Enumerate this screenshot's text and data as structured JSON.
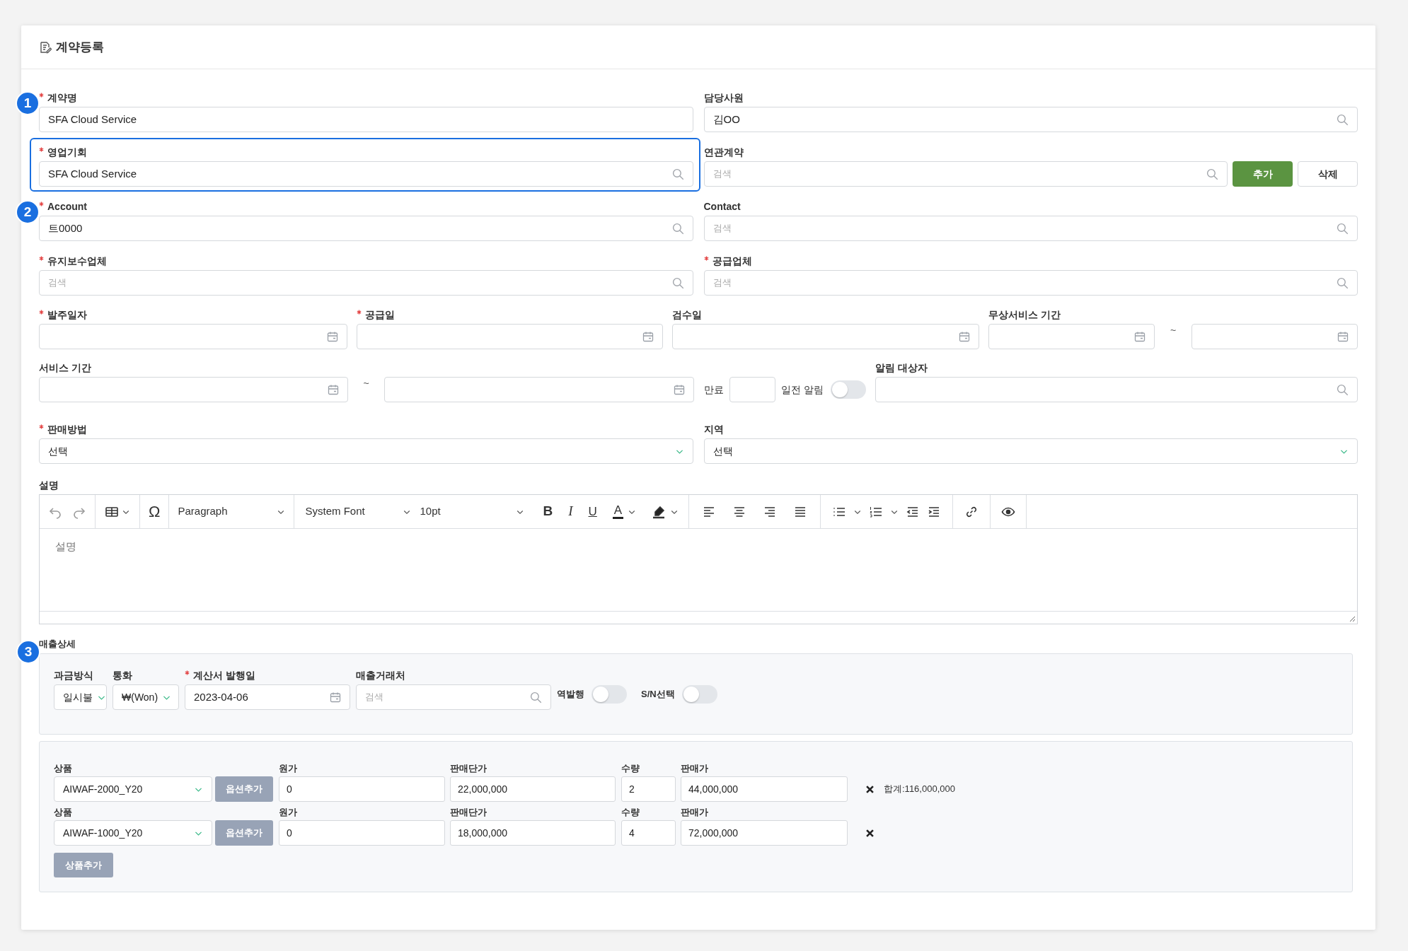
{
  "title": "계약등록",
  "main": [
    {
      "label": "계약명",
      "required": true,
      "kind": "text",
      "value": "SFA Cloud Service",
      "step": "1",
      "highlighted": false
    },
    {
      "label": "담당사원",
      "required": false,
      "kind": "search",
      "value": "김OO",
      "highlighted": false
    },
    {
      "label": "영업기회",
      "required": true,
      "kind": "search",
      "value": "SFA Cloud Service",
      "highlighted": true
    },
    {
      "label": "연관계약",
      "required": false,
      "kind": "search",
      "placeholder": "검색",
      "highlighted": false,
      "buttons": [
        {
          "label": "추가",
          "kind": "primary"
        },
        {
          "label": "삭제",
          "kind": "secondary"
        }
      ]
    },
    {
      "label": "Account",
      "required": true,
      "kind": "search",
      "value": "트0000",
      "step": "2",
      "highlighted": false
    },
    {
      "label": "Contact",
      "required": false,
      "kind": "search",
      "placeholder": "검색",
      "highlighted": false
    },
    {
      "label": "유지보수업체",
      "required": true,
      "kind": "search",
      "placeholder": "검색",
      "highlighted": false
    },
    {
      "label": "공급업체",
      "required": true,
      "kind": "search",
      "placeholder": "검색",
      "highlighted": false
    }
  ],
  "dates": [
    {
      "label": "발주일자",
      "required": true,
      "kind": "date"
    },
    {
      "label": "공급일",
      "required": true,
      "kind": "date"
    },
    {
      "label": "검수일",
      "required": false,
      "kind": "date"
    },
    {
      "label": "무상서비스 기간",
      "required": false,
      "kind": "date_range",
      "separator": "~"
    }
  ],
  "service": {
    "label": "서비스 기간",
    "separator": "~",
    "expiry_label": "만료",
    "notice": {
      "label": "일전 알림",
      "on": false
    },
    "recipients": {
      "label": "알림 대상자",
      "required": false,
      "kind": "search"
    }
  },
  "selects": [
    {
      "label": "판매방법",
      "required": true,
      "kind": "select",
      "value": "선택"
    },
    {
      "label": "지역",
      "required": false,
      "kind": "select",
      "value": "선택"
    }
  ],
  "description": {
    "label": "설명",
    "placeholder": "설명",
    "toolbar": {
      "special_char": "Ω",
      "block_format": "Paragraph",
      "font": "System Font",
      "font_size": "10pt",
      "bold": "B",
      "italic": "I",
      "underline": "U",
      "text_color": "A"
    }
  },
  "sales": {
    "label": "매출상세",
    "step": "3",
    "fields": [
      {
        "label": "과금방식",
        "required": false,
        "kind": "select",
        "value": "일시불"
      },
      {
        "label": "통화",
        "required": false,
        "kind": "select",
        "value": "₩(Won)"
      },
      {
        "label": "계산서 발행일",
        "required": true,
        "kind": "date",
        "value": "2023-04-06"
      },
      {
        "label": "매출거래처",
        "required": false,
        "kind": "search",
        "placeholder": "검색"
      }
    ],
    "toggles": [
      {
        "label": "역발행",
        "on": false
      },
      {
        "label": "S/N선택",
        "on": false
      }
    ],
    "products": [
      {
        "product_label": "상품",
        "product": "AIWAF-2000_Y20",
        "option_button": "옵션추가",
        "cost_label": "원가",
        "cost": "0",
        "unit_price_label": "판매단가",
        "unit_price": "22,000,000",
        "qty_label": "수량",
        "qty": "2",
        "price_label": "판매가",
        "price": "44,000,000",
        "total": "합계:116,000,000"
      },
      {
        "product_label": "상품",
        "product": "AIWAF-1000_Y20",
        "option_button": "옵션추가",
        "cost_label": "원가",
        "cost": "0",
        "unit_price_label": "판매단가",
        "unit_price": "18,000,000",
        "qty_label": "수량",
        "qty": "4",
        "price_label": "판매가",
        "price": "72,000,000"
      }
    ],
    "add_product": "상품추가"
  }
}
